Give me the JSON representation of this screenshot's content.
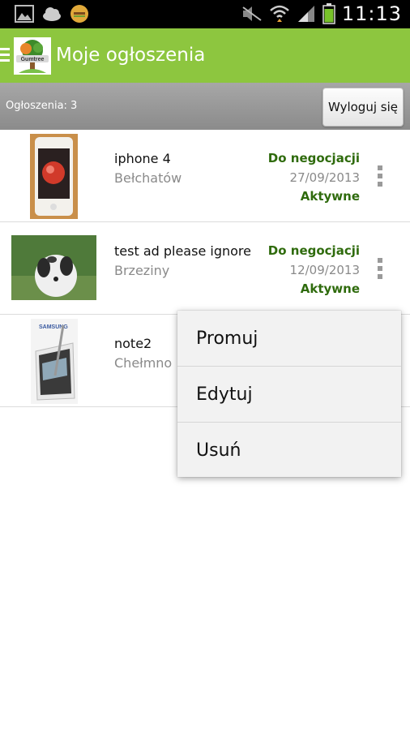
{
  "status_bar": {
    "time": "11:13",
    "icons": [
      "gallery-icon",
      "cloud-icon",
      "burger-icon",
      "mute-icon",
      "wifi-icon",
      "signal-icon",
      "battery-icon"
    ]
  },
  "app_bar": {
    "title": "Moje ogłoszenia",
    "logo_text": "Gumtree"
  },
  "sub_header": {
    "ads_count_label": "Ogłoszenia: 3",
    "logout_label": "Wyloguj się"
  },
  "ads": [
    {
      "title": "iphone 4",
      "location": "Bełchatów",
      "price_type": "Do negocjacji",
      "date": "27/09/2013",
      "status": "Aktywne"
    },
    {
      "title": "test ad please ignore",
      "location": "Brzeziny",
      "price_type": "Do negocjacji",
      "date": "12/09/2013",
      "status": "Aktywne"
    },
    {
      "title": "note2",
      "location": "Chełmno",
      "thumb_brand": "SAMSUNG"
    }
  ],
  "popup_menu": {
    "items": [
      {
        "label": "Promuj"
      },
      {
        "label": "Edytuj"
      },
      {
        "label": "Usuń"
      }
    ]
  },
  "colors": {
    "app_bar": "#8dc63f",
    "accent_text": "#2f6b0d"
  }
}
